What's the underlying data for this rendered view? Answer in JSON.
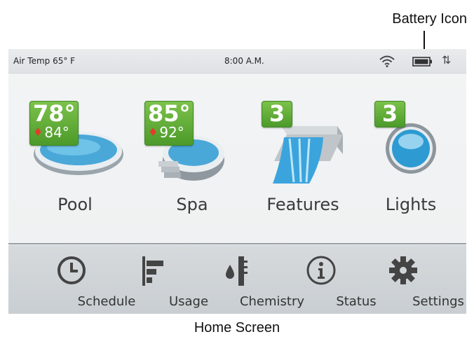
{
  "callout": {
    "battery_label": "Battery Icon"
  },
  "status_bar": {
    "air_temp": "Air Temp 65° F",
    "time": "8:00 A.M."
  },
  "tiles": [
    {
      "label": "Pool",
      "temp": "78°",
      "set_temp": "84°"
    },
    {
      "label": "Spa",
      "temp": "85°",
      "set_temp": "92°"
    },
    {
      "label": "Features",
      "count": "3"
    },
    {
      "label": "Lights",
      "count": "3"
    }
  ],
  "nav": [
    {
      "label": "Schedule",
      "icon": "clock-icon"
    },
    {
      "label": "Usage",
      "icon": "usage-bars-icon"
    },
    {
      "label": "Chemistry",
      "icon": "chemistry-drop-thermometer-icon"
    },
    {
      "label": "Status",
      "icon": "info-icon"
    },
    {
      "label": "Settings",
      "icon": "gear-icon"
    }
  ],
  "caption": "Home Screen",
  "colors": {
    "badge_green": "#5aab34",
    "flame_red": "#e43b2d",
    "water_blue": "#4aa8d8"
  }
}
